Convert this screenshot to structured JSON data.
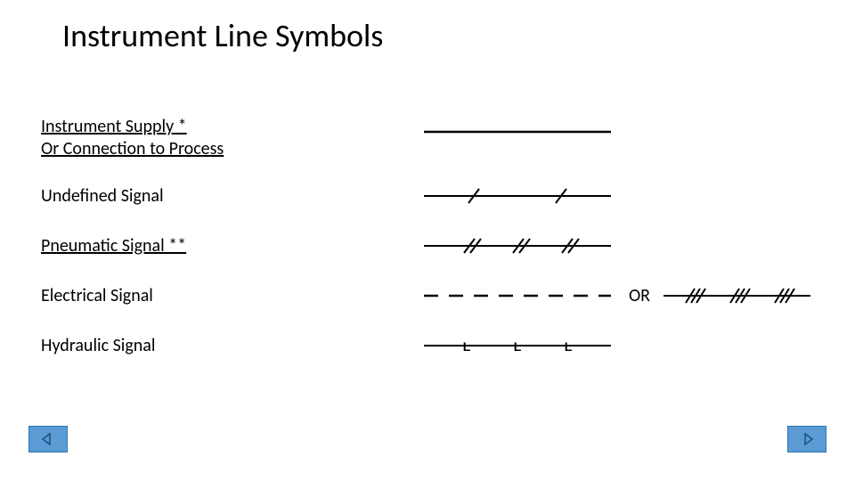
{
  "title": "Instrument Line Symbols",
  "rows": [
    {
      "label_line1": "Instrument Supply *",
      "label_line2": "Or Connection to Process",
      "underline": true,
      "symbol": "solid"
    },
    {
      "label": "Undefined Signal",
      "underline": false,
      "symbol": "single-slash"
    },
    {
      "label": "Pneumatic Signal **",
      "underline": true,
      "symbol": "double-slash"
    },
    {
      "label": "Electrical Signal",
      "underline": false,
      "symbol": "dashed",
      "or_label": "OR",
      "symbol2": "triple-slash"
    },
    {
      "label": "Hydraulic Signal",
      "underline": false,
      "symbol": "L-marks"
    }
  ],
  "nav": {
    "prev": "previous-slide",
    "next": "next-slide"
  }
}
